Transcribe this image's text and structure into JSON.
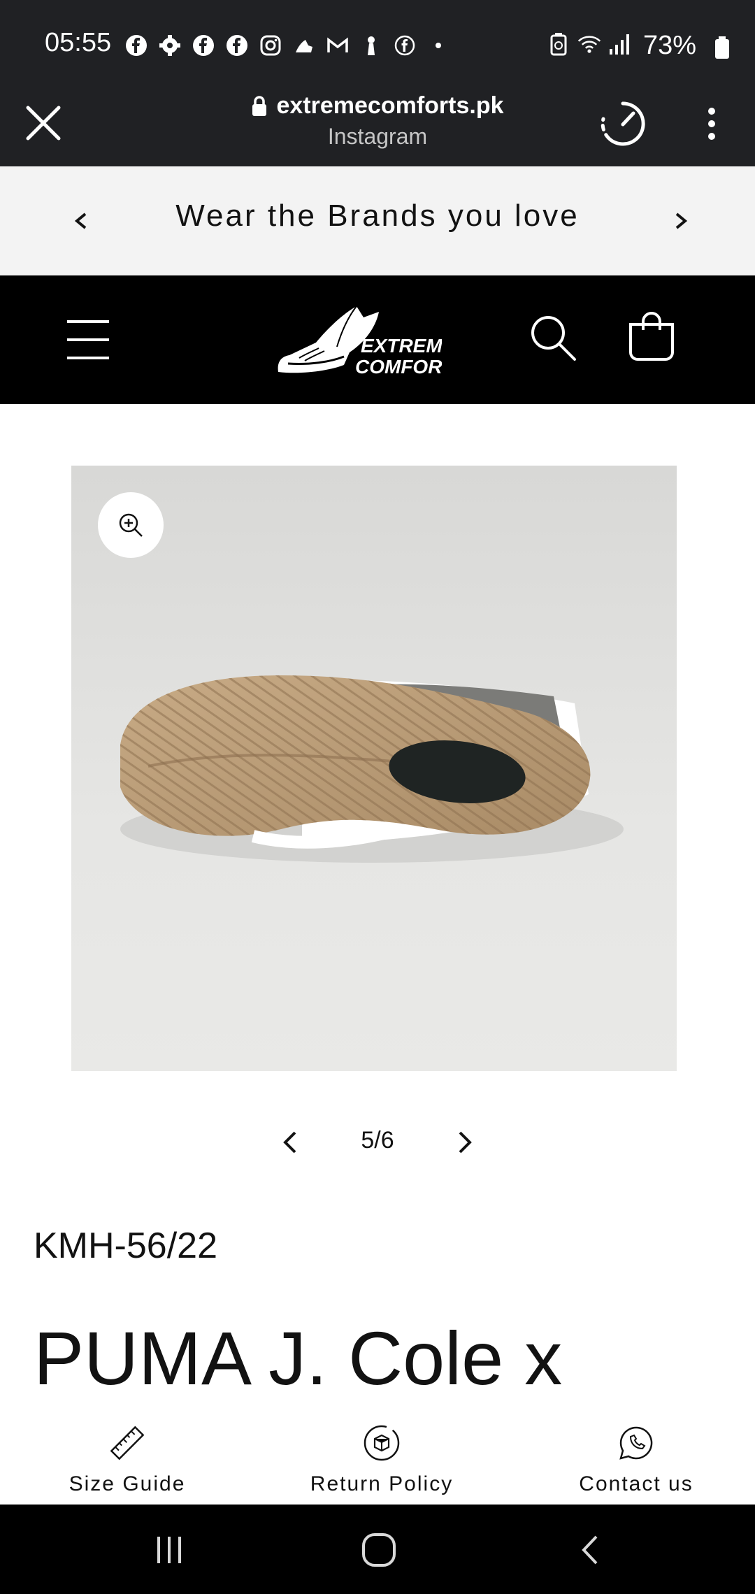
{
  "status_bar": {
    "time": "05:55",
    "battery": "73%",
    "notification_icons": [
      "facebook-icon",
      "gear-icon",
      "facebook-icon",
      "facebook-icon",
      "instagram-icon",
      "app-icon",
      "gmail-icon",
      "app-icon",
      "facebook-icon",
      "dot-icon"
    ],
    "system_icons": [
      "battery-saver-icon",
      "wifi-icon",
      "signal-icon",
      "battery-icon"
    ]
  },
  "browser": {
    "url": "extremecomforts.pk",
    "subtitle": "Instagram"
  },
  "announcement": {
    "text": "Wear the Brands you love"
  },
  "header": {
    "logo_line1": "EXTREME",
    "logo_line2": "COMFORTS"
  },
  "product": {
    "slide_counter": "5/6",
    "sku": "KMH-56/22",
    "title": "PUMA J. Cole x"
  },
  "bottom_bar": {
    "items": [
      {
        "label": "Size Guide",
        "icon": "ruler-icon"
      },
      {
        "label": "Return Policy",
        "icon": "return-box-icon"
      },
      {
        "label": "Contact us",
        "icon": "whatsapp-icon"
      }
    ]
  },
  "colors": {
    "status_bg": "#202124",
    "announce_bg": "#f3f3f3",
    "header_bg": "#000000",
    "text": "#121212"
  }
}
